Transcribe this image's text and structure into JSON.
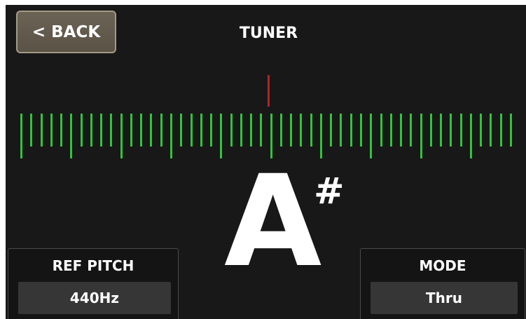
{
  "header": {
    "back_label": "< BACK",
    "title": "TUNER"
  },
  "tuner": {
    "note": "A",
    "accidental": "#",
    "colors": {
      "scale": "#2fc53a",
      "reference_marker": "#b02626"
    }
  },
  "ref_pitch": {
    "label": "REF PITCH",
    "value": "440Hz"
  },
  "mode": {
    "label": "MODE",
    "value": "Thru"
  }
}
